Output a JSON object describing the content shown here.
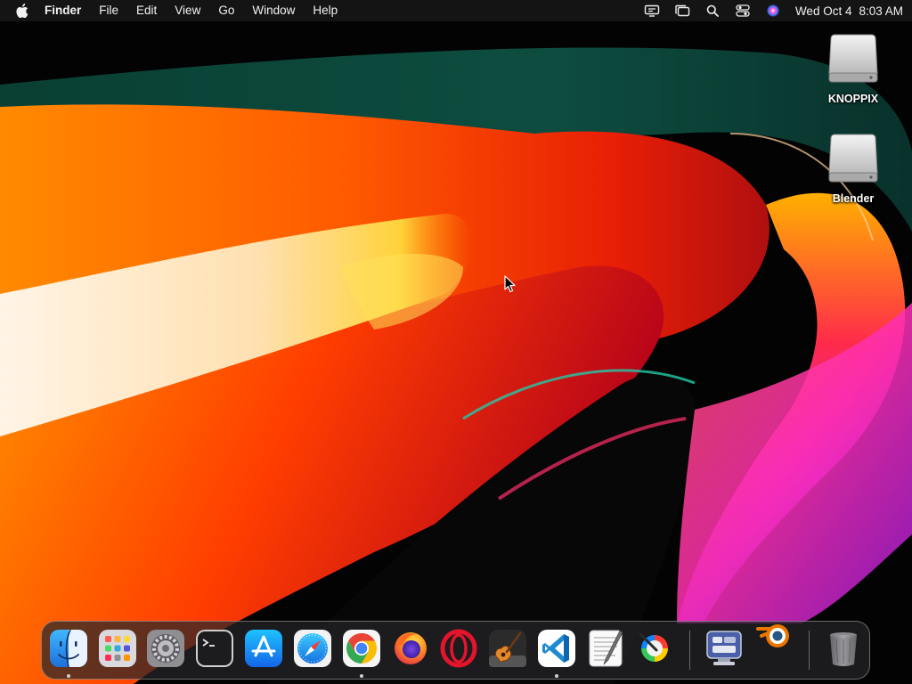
{
  "menubar": {
    "apple_icon": "apple-logo-icon",
    "app_name": "Finder",
    "menus": [
      "File",
      "Edit",
      "View",
      "Go",
      "Window",
      "Help"
    ],
    "status_icons": [
      "screen-mirroring-icon",
      "stage-manager-icon",
      "spotlight-search-icon",
      "control-center-icon",
      "siri-icon"
    ],
    "clock": {
      "date": "Wed Oct 4",
      "time": "8:03 AM"
    }
  },
  "desktop": {
    "icons": [
      {
        "label": "KNOPPIX",
        "icon": "disk-drive-icon"
      },
      {
        "label": "Blender",
        "icon": "disk-drive-icon"
      }
    ]
  },
  "dock": {
    "apps": [
      {
        "name": "finder",
        "running": true
      },
      {
        "name": "launchpad",
        "running": false
      },
      {
        "name": "system-settings",
        "running": false
      },
      {
        "name": "terminal",
        "running": false
      },
      {
        "name": "app-store",
        "running": false
      },
      {
        "name": "safari",
        "running": false
      },
      {
        "name": "chrome",
        "running": true
      },
      {
        "name": "firefox",
        "running": false
      },
      {
        "name": "opera",
        "running": false
      },
      {
        "name": "garageband",
        "running": false
      },
      {
        "name": "vscode",
        "running": true
      },
      {
        "name": "textedit",
        "running": false
      },
      {
        "name": "pixelmator",
        "running": false
      },
      {
        "name": "remote-desktop",
        "running": false
      },
      {
        "name": "blender",
        "running": false
      },
      {
        "name": "trash",
        "running": false
      }
    ]
  },
  "colors": {
    "menubar_bg": "#161616",
    "dock_bg": "#26262a",
    "wallpaper_accent": "#ff5a00"
  }
}
